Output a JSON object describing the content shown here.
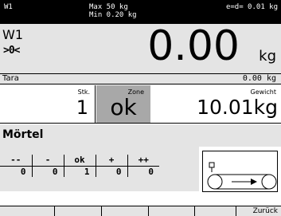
{
  "topbar": {
    "scale_id": "W1",
    "max_label": "Max 50 kg",
    "min_label": "Min 0.20 kg",
    "e_d": "e=d= 0.01 kg"
  },
  "weigh": {
    "name": "W1",
    "zero_indicator": ">0<",
    "value": "0.00",
    "unit": "kg"
  },
  "tara": {
    "label": "Tara",
    "value": "0.00 kg"
  },
  "result": {
    "stk_header": "Stk.",
    "stk_value": "1",
    "zone_header": "Zone",
    "zone_value": "ok",
    "gewicht_header": "Gewicht",
    "gewicht_value": "10.01kg"
  },
  "product": {
    "name": "Mörtel"
  },
  "zone_table": {
    "headers": [
      "--",
      "-",
      "ok",
      "+",
      "++"
    ],
    "counts": [
      "0",
      "0",
      "1",
      "0",
      "0"
    ]
  },
  "conveyor_icon": "conveyor-belt-icon",
  "footer": {
    "back_label": "Zurück"
  },
  "colors": {
    "topbar_bg": "#000000",
    "panel_bg": "#e4e4e4",
    "zone_ok_bg": "#a8a8a8"
  }
}
